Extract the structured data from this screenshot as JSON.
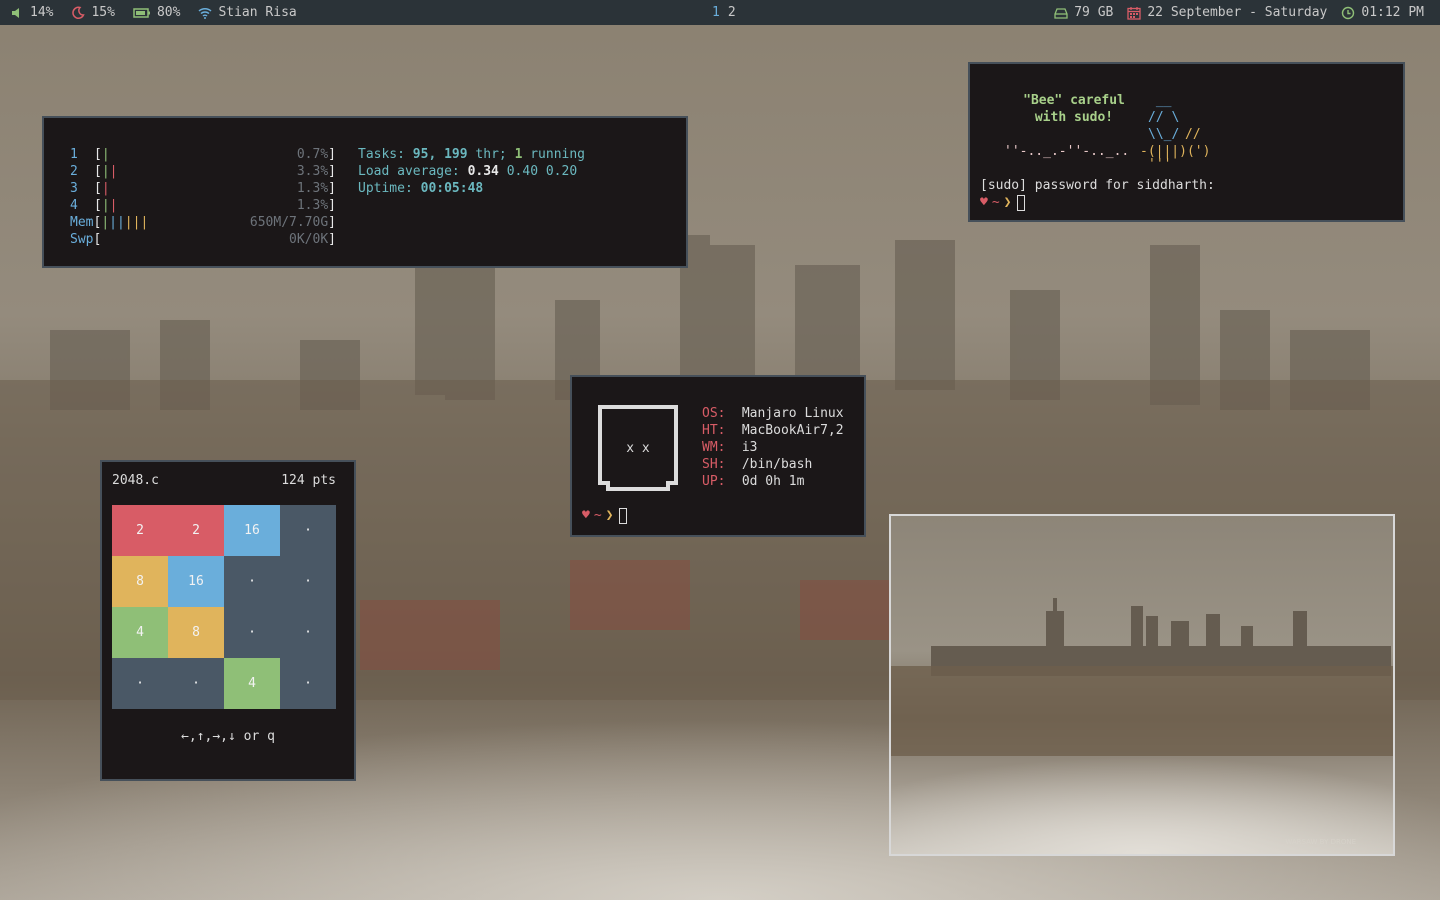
{
  "topbar": {
    "volume": "14%",
    "night": "15%",
    "battery": "80%",
    "wifi": "Stian Risa",
    "workspaces": [
      "1",
      "2"
    ],
    "disk": "79 GB",
    "date": "22 September - Saturday",
    "time": "01:12 PM"
  },
  "htop": {
    "cpus": [
      {
        "label": "1",
        "pct": "0.7%"
      },
      {
        "label": "2",
        "pct": "3.3%"
      },
      {
        "label": "3",
        "pct": "1.3%"
      },
      {
        "label": "4",
        "pct": "1.3%"
      }
    ],
    "mem_label": "Mem",
    "mem_value": "650M/7.70G",
    "swp_label": "Swp",
    "swp_value": "0K/0K",
    "tasks_label": "Tasks:",
    "tasks": "95,",
    "threads": "199",
    "thr_label": "thr;",
    "running_count": "1",
    "running_label": "running",
    "load_label": "Load average:",
    "load1": "0.34",
    "load5": "0.40",
    "load15": "0.20",
    "uptime_label": "Uptime:",
    "uptime": "00:05:48"
  },
  "sudo": {
    "line1": "\"Bee\" careful",
    "line2": "with sudo!",
    "prompt_text": "[sudo] password for siddharth:"
  },
  "fetch": {
    "logo_eyes": "x  x",
    "rows": [
      {
        "k": "OS:",
        "v": "Manjaro Linux"
      },
      {
        "k": "HT:",
        "v": "MacBookAir7,2"
      },
      {
        "k": "WM:",
        "v": "i3"
      },
      {
        "k": "SH:",
        "v": "/bin/bash"
      },
      {
        "k": "UP:",
        "v": "0d 0h 1m"
      }
    ]
  },
  "prompt": {
    "heart": "♥",
    "tilde": "~",
    "arrow": "❯"
  },
  "game": {
    "title": "2048.c",
    "score": "124 pts",
    "tiles": [
      [
        "2",
        "2",
        "16",
        "·"
      ],
      [
        "8",
        "16",
        "·",
        "·"
      ],
      [
        "4",
        "8",
        "·",
        "·"
      ],
      [
        "·",
        "·",
        "4",
        "·"
      ]
    ],
    "controls": "←,↑,→,↓ or q"
  },
  "viewer": {
    "watermark": "WARSAW BY DRONE"
  },
  "colors": {
    "red": "#d85c66",
    "yellow": "#e0b45c",
    "blue": "#6aaedb",
    "green": "#8fbf77",
    "empty": "#4a5866"
  }
}
